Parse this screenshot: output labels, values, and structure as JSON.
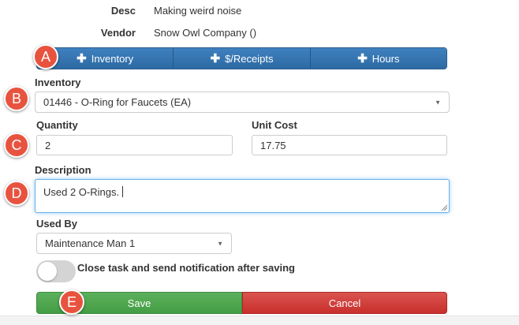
{
  "info": {
    "desc_label": "Desc",
    "desc_value": "Making weird noise",
    "vendor_label": "Vendor",
    "vendor_value": "Snow Owl Company ()"
  },
  "tabs": [
    {
      "label": "Inventory",
      "icon": "plus-icon"
    },
    {
      "label": "$/Receipts",
      "icon": "plus-icon"
    },
    {
      "label": "Hours",
      "icon": "plus-icon"
    }
  ],
  "form": {
    "inventory_label": "Inventory",
    "inventory_value": "01446 - O-Ring for Faucets (EA)",
    "quantity_label": "Quantity",
    "quantity_value": "2",
    "unit_cost_label": "Unit Cost",
    "unit_cost_value": "17.75",
    "description_label": "Description",
    "description_value": "Used 2 O-Rings.",
    "used_by_label": "Used By",
    "used_by_value": "Maintenance Man 1",
    "toggle_label": "Close task and send notification after saving",
    "toggle_on": false
  },
  "actions": {
    "save_label": "Save",
    "cancel_label": "Cancel"
  },
  "markers": [
    "A",
    "B",
    "C",
    "D",
    "E"
  ],
  "colors": {
    "primary": "#337ab7",
    "success": "#4cae4c",
    "danger": "#d43f3a",
    "marker": "#e8533f"
  }
}
